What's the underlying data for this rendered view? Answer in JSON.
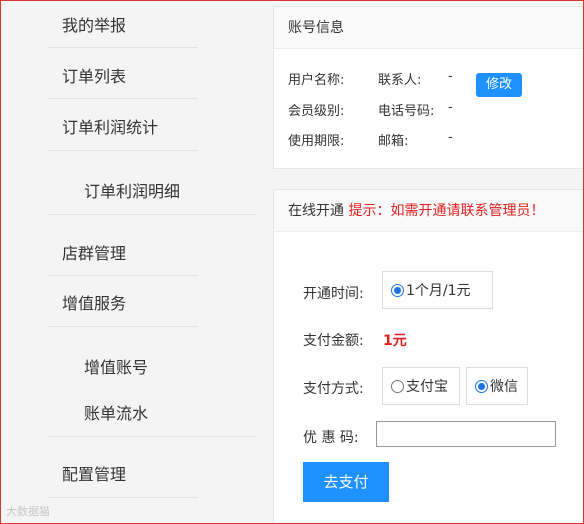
{
  "sidebar": {
    "items": [
      {
        "label": "我的举报"
      },
      {
        "label": "订单列表"
      },
      {
        "label": "订单利润统计"
      },
      {
        "label": "订单利润明细"
      },
      {
        "label": "店群管理"
      },
      {
        "label": "增值服务"
      },
      {
        "label": "增值账号"
      },
      {
        "label": "账单流水"
      },
      {
        "label": "配置管理"
      }
    ]
  },
  "account": {
    "title": "账号信息",
    "username_label": "用户名称:",
    "contact_label": "联系人:",
    "contact_value": "-",
    "edit_button": "修改",
    "level_label": "会员级别:",
    "phone_label": "电话号码:",
    "phone_value": "-",
    "expiry_label": "使用期限:",
    "email_label": "邮箱:",
    "email_value": "-"
  },
  "activation": {
    "title": "在线开通",
    "hint": "提示：如需开通请联系管理员！",
    "duration_label": "开通时间:",
    "duration_option": "1个月/1元",
    "amount_label": "支付金额:",
    "amount_value": "1元",
    "method_label": "支付方式:",
    "method_alipay": "支付宝",
    "method_wechat": "微信",
    "coupon_label": "优 惠 码:",
    "coupon_value": "",
    "pay_button": "去支付"
  },
  "watermark": "大数据猫"
}
